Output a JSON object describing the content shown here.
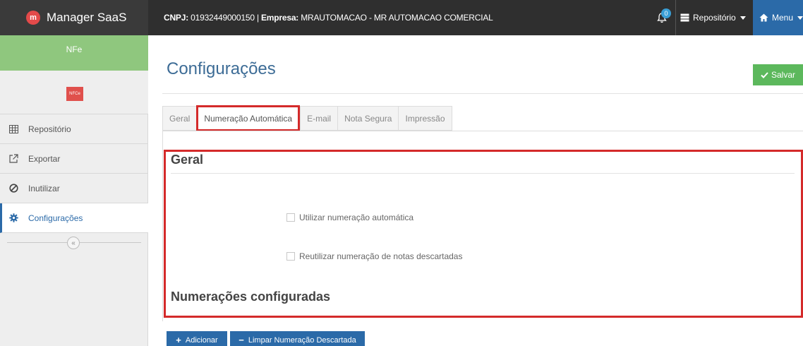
{
  "topbar": {
    "brand_logo_letter": "m",
    "brand_name": "Manager SaaS",
    "cnpj_label": "CNPJ:",
    "cnpj_value": "01932449000150",
    "divider": "|",
    "empresa_label": "Empresa:",
    "empresa_value": "MRAUTOMACAO - MR AUTOMACAO COMERCIAL",
    "notification_count": "0",
    "repo_label": "Repositório",
    "menu_label": "Menu"
  },
  "sidebar": {
    "nfe_label": "NFe",
    "nfce_label": "NFCe",
    "items": [
      {
        "label": "Repositório",
        "icon": "table-icon"
      },
      {
        "label": "Exportar",
        "icon": "external-link-icon"
      },
      {
        "label": "Inutilizar",
        "icon": "ban-icon"
      },
      {
        "label": "Configurações",
        "icon": "gear-icon"
      }
    ],
    "collapse_glyph": "«"
  },
  "main": {
    "title": "Configurações",
    "save_label": "Salvar",
    "tabs": [
      {
        "label": "Geral"
      },
      {
        "label": "Numeração Automática"
      },
      {
        "label": "E-mail"
      },
      {
        "label": "Nota Segura"
      },
      {
        "label": "Impressão"
      }
    ],
    "active_tab": "Numeração Automática",
    "section_geral": "Geral",
    "checkbox_auto": "Utilizar numeração automática",
    "checkbox_reuse": "Reutilizar numeração de notas descartadas",
    "section_numeracoes": "Numerações configuradas",
    "add_label": "Adicionar",
    "clear_label": "Limpar Numeração Descartada"
  },
  "colors": {
    "topbar": "#2f2f2f",
    "accent_blue": "#2b6aa8",
    "nfe_green": "#8fc77e",
    "nfce_red": "#e0504c",
    "save_green": "#5cb85c",
    "highlight_red": "#d42a2a"
  }
}
